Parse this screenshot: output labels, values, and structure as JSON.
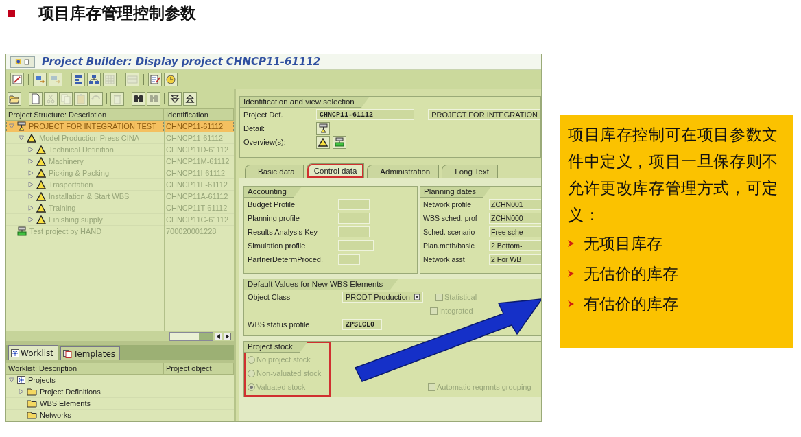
{
  "heading": "项目库存管理控制参数",
  "window": {
    "title": "Project Builder: Display project CHNCP11-61112"
  },
  "main_toolbar": [
    {
      "kind": "edit",
      "disabled": false
    },
    {
      "kind": "separator"
    },
    {
      "kind": "transfer",
      "disabled": false
    },
    {
      "kind": "transfer",
      "disabled": true
    },
    {
      "kind": "separator"
    },
    {
      "kind": "hierarchy",
      "disabled": false
    },
    {
      "kind": "network",
      "disabled": false
    },
    {
      "kind": "grid",
      "disabled": true
    },
    {
      "kind": "separator"
    },
    {
      "kind": "table",
      "disabled": true
    },
    {
      "kind": "separator"
    },
    {
      "kind": "notes",
      "disabled": false
    },
    {
      "kind": "clock",
      "disabled": false
    }
  ],
  "tree_toolbar": [
    {
      "kind": "open",
      "disabled": false
    },
    {
      "kind": "separator"
    },
    {
      "kind": "new",
      "disabled": false
    },
    {
      "kind": "cut",
      "disabled": true
    },
    {
      "kind": "copy",
      "disabled": true
    },
    {
      "kind": "paste",
      "disabled": true
    },
    {
      "kind": "undo",
      "disabled": true
    },
    {
      "kind": "separator"
    },
    {
      "kind": "delete",
      "disabled": true
    },
    {
      "kind": "separator"
    },
    {
      "kind": "find",
      "disabled": false
    },
    {
      "kind": "find-next",
      "disabled": true
    },
    {
      "kind": "separator"
    },
    {
      "kind": "expand",
      "disabled": false
    },
    {
      "kind": "collapse",
      "disabled": false
    }
  ],
  "tree": {
    "columns": [
      "Project Structure: Description",
      "Identification"
    ],
    "rows": [
      {
        "label": "PROJECT FOR INTEGRATION TEST",
        "id": "CHNCP11-61112",
        "kind": "project",
        "selected": true,
        "expanded": true,
        "children": [
          {
            "label": "Model Production Press CINA",
            "id": "CHNCP11-61112",
            "kind": "wbs",
            "selected": false,
            "expanded": true,
            "children": [
              {
                "label": "Technical Definition",
                "id": "CHNCP11D-61112",
                "kind": "wbs",
                "selected": false,
                "expanded": false
              },
              {
                "label": "Machinery",
                "id": "CHNCP11M-61112",
                "kind": "wbs",
                "selected": false,
                "expanded": false
              },
              {
                "label": "Picking & Packing",
                "id": "CHNCP11I-61112",
                "kind": "wbs",
                "selected": false,
                "expanded": false
              },
              {
                "label": "Trasportation",
                "id": "CHNCP11F-61112",
                "kind": "wbs",
                "selected": false,
                "expanded": false
              },
              {
                "label": "Installation & Start WBS",
                "id": "CHNCP11A-61112",
                "kind": "wbs",
                "selected": false,
                "expanded": false
              },
              {
                "label": "Training",
                "id": "CHNCP11T-61112",
                "kind": "wbs",
                "selected": false,
                "expanded": false
              },
              {
                "label": "Finishing supply",
                "id": "CHNCP11C-61112",
                "kind": "wbs",
                "selected": false,
                "expanded": false
              }
            ]
          }
        ]
      },
      {
        "label": "Test project by HAND",
        "id": "700020001228",
        "kind": "network",
        "selected": false
      }
    ]
  },
  "worklist_tabs": [
    {
      "label": "Worklist",
      "kind": "worklist",
      "selected": true
    },
    {
      "label": "Templates",
      "kind": "templates",
      "selected": false
    }
  ],
  "worklist": {
    "columns": [
      "Worklist: Description",
      "Project object"
    ],
    "rows": [
      {
        "label": "Projects",
        "kind": "worklist",
        "expanded": true,
        "children": [
          {
            "label": "Project Definitions",
            "kind": "folder",
            "expanded": false
          },
          {
            "label": "WBS Elements",
            "kind": "folder"
          },
          {
            "label": "Networks",
            "kind": "folder"
          }
        ]
      }
    ]
  },
  "identification": {
    "title": "Identification and view selection",
    "project_def_label": "Project Def.",
    "project_def": "CHNCP11-61112",
    "project_desc": "PROJECT FOR INTEGRATION",
    "detail_label": "Detail:",
    "detail_buttons": [
      {
        "kind": "project"
      }
    ],
    "overview_label": "Overview(s):",
    "overview_buttons": [
      {
        "kind": "wbs"
      },
      {
        "kind": "network"
      }
    ]
  },
  "tabs": [
    {
      "label": "Basic data",
      "selected": false,
      "highlighted": false
    },
    {
      "label": "Control data",
      "selected": true,
      "highlighted": true
    },
    {
      "label": "Administration",
      "selected": false,
      "highlighted": false
    },
    {
      "label": "Long Text",
      "selected": false,
      "highlighted": false
    }
  ],
  "accounting": {
    "title": "Accounting",
    "fields": [
      {
        "label": "Budget Profile"
      },
      {
        "label": "Planning profile"
      },
      {
        "label": "Results Analysis Key"
      },
      {
        "label": "Simulation profile"
      },
      {
        "label": "PartnerDetermProced."
      }
    ]
  },
  "planning_dates": {
    "title": "Planning dates",
    "fields": [
      {
        "label": "Network profile",
        "value": "ZCHN001"
      },
      {
        "label": "WBS sched. prof",
        "value": "ZCHN000"
      },
      {
        "label": "Sched. scenario",
        "value": "Free sche"
      },
      {
        "label": "Plan.meth/basic",
        "value": "2 Bottom-"
      },
      {
        "label": "Network asst",
        "value": "2 For WB"
      }
    ]
  },
  "defaults": {
    "title": "Default Values for New WBS Elements",
    "object_class_label": "Object Class",
    "object_class": "PRODT Production",
    "status_profile_label": "WBS status profile",
    "status_profile": "ZPSLCL0",
    "checkboxes": [
      {
        "label": "Statistical",
        "checked": false
      },
      {
        "label": "Integrated",
        "checked": false
      }
    ]
  },
  "project_stock": {
    "title": "Project stock",
    "highlighted": true,
    "options": [
      {
        "label": "No project stock",
        "selected": false
      },
      {
        "label": "Non-valuated stock",
        "selected": false
      },
      {
        "label": "Valuated stock",
        "selected": true
      }
    ],
    "grouping": {
      "label": "Automatic reqmnts grouping",
      "checked": false
    }
  },
  "callout": {
    "text": "项目库存控制可在项目参数文件中定义，项目一旦保存则不允许更改库存管理方式，可定义：",
    "bullets": [
      "无项目库存",
      "无估价的库存",
      "有估价的库存"
    ]
  }
}
